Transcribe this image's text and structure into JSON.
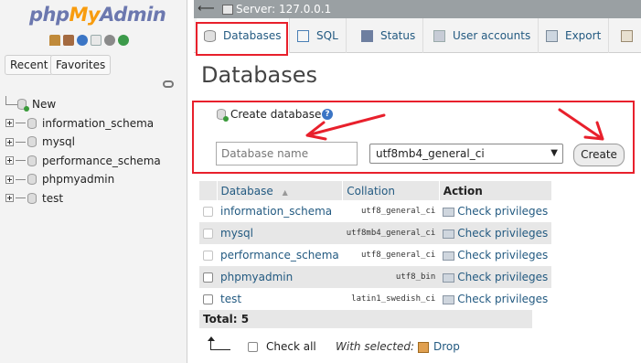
{
  "nav": {
    "logo": {
      "php": "php",
      "my": "My",
      "admin": "Admin"
    },
    "icons": [
      "home-icon",
      "exit-icon",
      "help-icon",
      "docs-icon",
      "settings-icon",
      "reload-icon"
    ],
    "tabs": {
      "recent": "Recent",
      "favorites": "Favorites"
    },
    "tree": [
      {
        "label": "New",
        "kind": "new"
      },
      {
        "label": "information_schema",
        "kind": "db"
      },
      {
        "label": "mysql",
        "kind": "db"
      },
      {
        "label": "performance_schema",
        "kind": "db"
      },
      {
        "label": "phpmyadmin",
        "kind": "db"
      },
      {
        "label": "test",
        "kind": "db"
      }
    ]
  },
  "header": {
    "server": "Server: 127.0.0.1",
    "tabs": {
      "databases": "Databases",
      "sql": "SQL",
      "status": "Status",
      "users": "User accounts",
      "export": "Export"
    }
  },
  "main": {
    "title": "Databases",
    "create": {
      "label": "Create database",
      "name_placeholder": "Database name",
      "collation": "utf8mb4_general_ci",
      "button": "Create"
    },
    "table": {
      "headers": {
        "database": "Database",
        "collation": "Collation",
        "action": "Action"
      },
      "rows": [
        {
          "name": "information_schema",
          "collation": "utf8_general_ci",
          "action": "Check privileges"
        },
        {
          "name": "mysql",
          "collation": "utf8mb4_general_ci",
          "action": "Check privileges"
        },
        {
          "name": "performance_schema",
          "collation": "utf8_general_ci",
          "action": "Check privileges"
        },
        {
          "name": "phpmyadmin",
          "collation": "utf8_bin",
          "action": "Check privileges"
        },
        {
          "name": "test",
          "collation": "latin1_swedish_ci",
          "action": "Check privileges"
        }
      ],
      "total": "Total: 5"
    },
    "bulk": {
      "check_all": "Check all",
      "with_selected": "With selected:",
      "drop": "Drop"
    }
  },
  "colors": {
    "annotation": "#e8202c",
    "link": "#235a81",
    "header_bar": "#9aa0a3"
  }
}
